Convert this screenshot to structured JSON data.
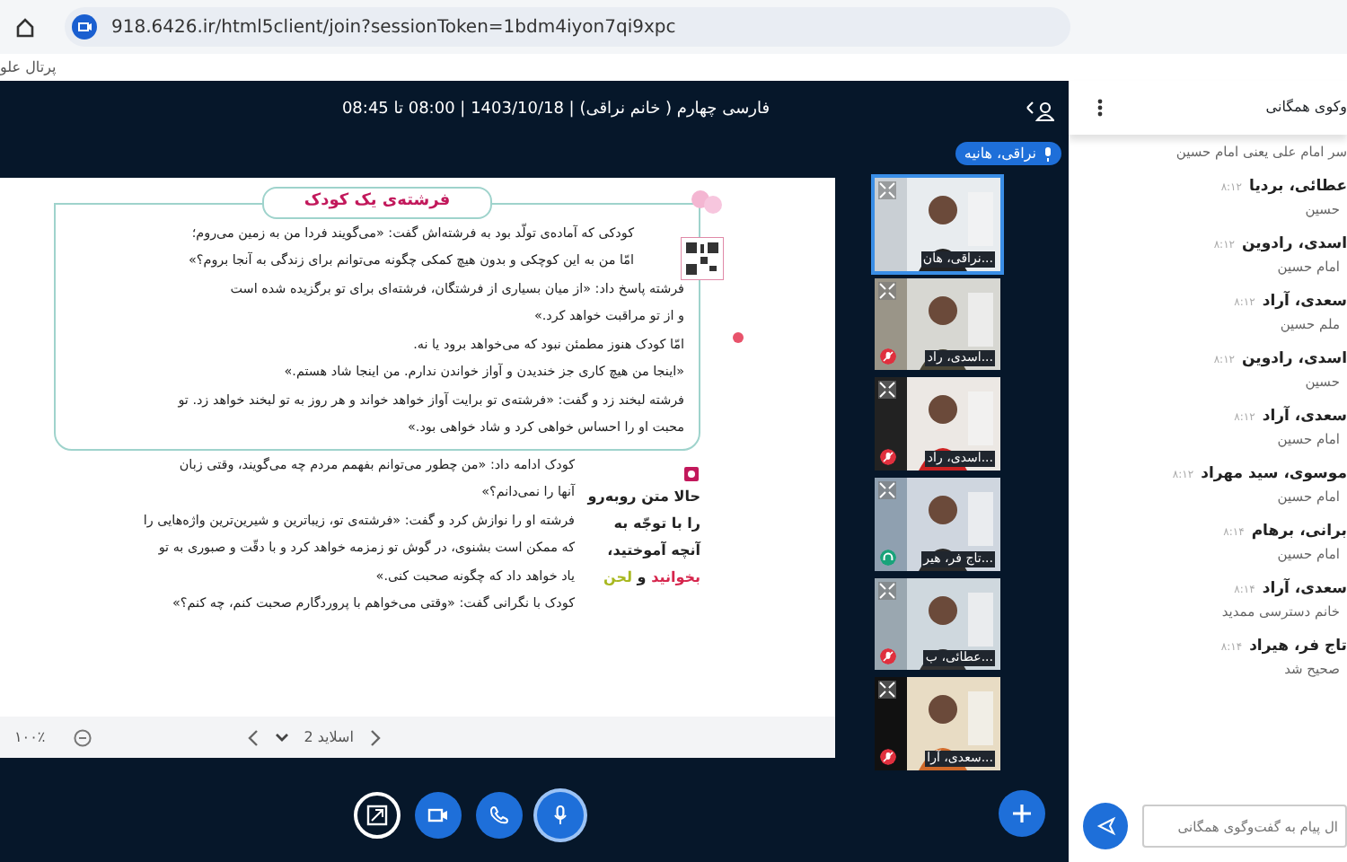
{
  "browser": {
    "url": "918.6426.ir/html5client/join?sessionToken=1bdm4iyon7qi9xpc",
    "bookmarks": [
      "پرتال علو"
    ]
  },
  "meeting": {
    "title": "فارسی چهارم ( خانم نراقی) | 1403/10/18 | 08:00 تا 08:45",
    "talking": [
      "نراقی، هانیه"
    ]
  },
  "slide": {
    "title": "فرشته‌ی یک کودک",
    "box_lines": [
      "کودکی که آماده‌ی تولّد بود به فرشته‌اش گفت: «می‌گویند فردا من به زمین می‌روم؛",
      "امّا من به این کوچکی و بدون هیچ کمکی چگونه می‌توانم برای زندگی به آنجا بروم؟»",
      "فرشته پاسخ داد: «از میان بسیاری از فرشتگان، فرشته‌ای برای تو برگزیده شده است",
      "و از تو مراقبت خواهد کرد.»",
      "امّا کودک هنوز مطمئن نبود که می‌خواهد برود یا نه.",
      "«اینجا من هیچ کاری جز خندیدن و آواز خواندن ندارم. من اینجا شاد هستم.»",
      "فرشته لبخند زد و گفت: «فرشته‌ی تو برایت آواز خواهد خواند و هر روز به تو لبخند خواهد زد. تو",
      "محبت او را احساس خواهی کرد و شاد خواهی بود.»"
    ],
    "lines": [
      "کودک ادامه داد: «من چطور می‌توانم بفهمم مردم چه می‌گویند، وقتی زبان",
      "آنها را نمی‌دانم؟»",
      "فرشته او را نوازش کرد و گفت: «فرشته‌ی تو، زیباترین و شیرین‌ترین واژه‌هایی را",
      "که ممکن است بشنوی، در گوش تو زمزمه خواهد کرد و با دقّت و صبوری به تو",
      "یاد خواهد داد که چگونه صحبت کنی.»",
      "کودک با نگرانی گفت: «وقتی می‌خواهم با پروردگارم صحبت کنم، چه کنم؟»"
    ],
    "side_lines": [
      [
        {
          "text": "حالا متن روبه‌رو",
          "color": "#222222"
        }
      ],
      [
        {
          "text": "را با توجّه به",
          "color": "#222222"
        }
      ],
      [
        {
          "text": "آنچه آموختید،",
          "color": "#222222"
        }
      ],
      [
        {
          "text": "بخوانید",
          "color": "#d6264d"
        },
        {
          "text": "و",
          "color": "#222222"
        },
        {
          "text": "لحن",
          "color": "#a8b820"
        }
      ]
    ],
    "zoom": "۱۰۰٪",
    "slide_label": "اسلاید 2"
  },
  "videos": [
    {
      "name": "نراقی، هان...",
      "talking": true,
      "muted": false,
      "listen_only": false
    },
    {
      "name": "اسدی، راد...",
      "talking": false,
      "muted": true,
      "listen_only": false
    },
    {
      "name": "اسدی، راد...",
      "talking": false,
      "muted": true,
      "listen_only": false
    },
    {
      "name": "تاج فر، هیر...",
      "talking": false,
      "muted": false,
      "listen_only": true
    },
    {
      "name": "عطائی، ب...",
      "talking": false,
      "muted": true,
      "listen_only": false
    },
    {
      "name": "سعدی، آرا...",
      "talking": false,
      "muted": true,
      "listen_only": false
    }
  ],
  "controls": [
    {
      "kind": "screen-share"
    },
    {
      "kind": "camera"
    },
    {
      "kind": "phone"
    },
    {
      "kind": "mic"
    }
  ],
  "chat": {
    "title": "وکوی همگانی",
    "messages": [
      {
        "text": "سر امام علی یعنی امام حسین"
      },
      {
        "name": "عطائی، بردیا",
        "time": "۸:۱۲",
        "text": "حسین"
      },
      {
        "name": "اسدی، رادوین",
        "time": "۸:۱۲",
        "text": "امام حسین"
      },
      {
        "name": "سعدی، آراد",
        "time": "۸:۱۲",
        "text": "ملم حسین"
      },
      {
        "name": "اسدی، رادوین",
        "time": "۸:۱۲",
        "text": "حسین"
      },
      {
        "name": "سعدی، آراد",
        "time": "۸:۱۲",
        "text": "امام حسین"
      },
      {
        "name": "موسوی، سید مهراد",
        "time": "۸:۱۲",
        "text": "امام حسین"
      },
      {
        "name": "برانی، برهام",
        "time": "۸:۱۴",
        "text": "امام حسین"
      },
      {
        "name": "سعدی، آراد",
        "time": "۸:۱۴",
        "text": "خانم دسترسی ممدید"
      },
      {
        "name": "تاج فر، هیراد",
        "time": "۸:۱۴",
        "text": "صحیح شد"
      }
    ],
    "placeholder": "ال پیام به گفت‌وگوی همگانی"
  }
}
